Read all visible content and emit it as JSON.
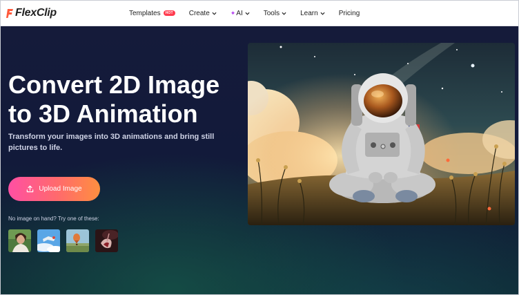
{
  "brand": {
    "name": "FlexClip"
  },
  "nav": {
    "items": [
      {
        "label": "Templates",
        "badge": "HOT",
        "dropdown": false,
        "icon": ""
      },
      {
        "label": "Create",
        "badge": "",
        "dropdown": true,
        "icon": ""
      },
      {
        "label": "AI",
        "badge": "",
        "dropdown": true,
        "icon": "sparkle-icon"
      },
      {
        "label": "Tools",
        "badge": "",
        "dropdown": true,
        "icon": ""
      },
      {
        "label": "Learn",
        "badge": "",
        "dropdown": true,
        "icon": ""
      },
      {
        "label": "Pricing",
        "badge": "",
        "dropdown": false,
        "icon": ""
      }
    ]
  },
  "hero": {
    "title": "Convert 2D Image to 3D Animation",
    "subtitle": "Transform your images into 3D animations and bring still pictures to life.",
    "upload_label": "Upload Image",
    "sample_label": "No image on hand? Try one of these:",
    "samples": [
      "woman-portrait",
      "person-skydiving",
      "hot-air-balloon",
      "wine-pour"
    ]
  },
  "colors": {
    "accent_start": "#ff4fa3",
    "accent_end": "#ff8f3f",
    "hot_badge": "#ff3b4e",
    "ai_sparkle": "#b33ff0",
    "hero_bg": "#141b3a"
  }
}
